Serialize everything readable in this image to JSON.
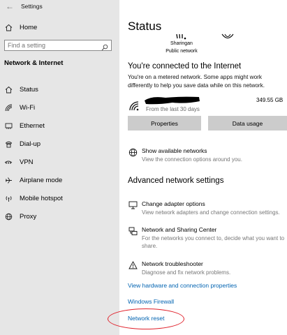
{
  "window": {
    "title": "Settings",
    "back_glyph": "←"
  },
  "sidebar": {
    "home_label": "Home",
    "search_placeholder": "Find a setting",
    "section_heading": "Network & Internet",
    "items": [
      {
        "label": "Status",
        "icon": "home-icon"
      },
      {
        "label": "Wi-Fi",
        "icon": "wifi-icon"
      },
      {
        "label": "Ethernet",
        "icon": "ethernet-icon"
      },
      {
        "label": "Dial-up",
        "icon": "dialup-icon"
      },
      {
        "label": "VPN",
        "icon": "vpn-icon"
      },
      {
        "label": "Airplane mode",
        "icon": "airplane-icon"
      },
      {
        "label": "Mobile hotspot",
        "icon": "hotspot-icon"
      },
      {
        "label": "Proxy",
        "icon": "globe-icon"
      }
    ]
  },
  "main": {
    "title": "Status",
    "network": {
      "name": "Sharingan",
      "kind": "Public network"
    },
    "connection": {
      "heading": "You're connected to the Internet",
      "description": "You're on a metered network. Some apps might work differently to help you save data while on this network."
    },
    "usage": {
      "period": "From the last 30 days",
      "amount": "349.55 GB"
    },
    "buttons": {
      "properties": "Properties",
      "data_usage": "Data usage"
    },
    "show_networks": {
      "label": "Show available networks",
      "desc": "View the connection options around you."
    },
    "advanced": {
      "heading": "Advanced network settings",
      "items": [
        {
          "label": "Change adapter options",
          "desc": "View network adapters and change connection settings.",
          "icon": "adapter-icon"
        },
        {
          "label": "Network and Sharing Center",
          "desc": "For the networks you connect to, decide what you want to share.",
          "icon": "sharing-center-icon"
        },
        {
          "label": "Network troubleshooter",
          "desc": "Diagnose and fix network problems.",
          "icon": "warning-icon"
        }
      ]
    },
    "links": {
      "hardware": "View hardware and connection properties",
      "firewall": "Windows Firewall",
      "reset": "Network reset"
    }
  },
  "colors": {
    "sidebar_bg": "#e6e6e6",
    "link": "#0063b1",
    "button_bg": "#cccccc",
    "annotation": "#e0202a"
  }
}
